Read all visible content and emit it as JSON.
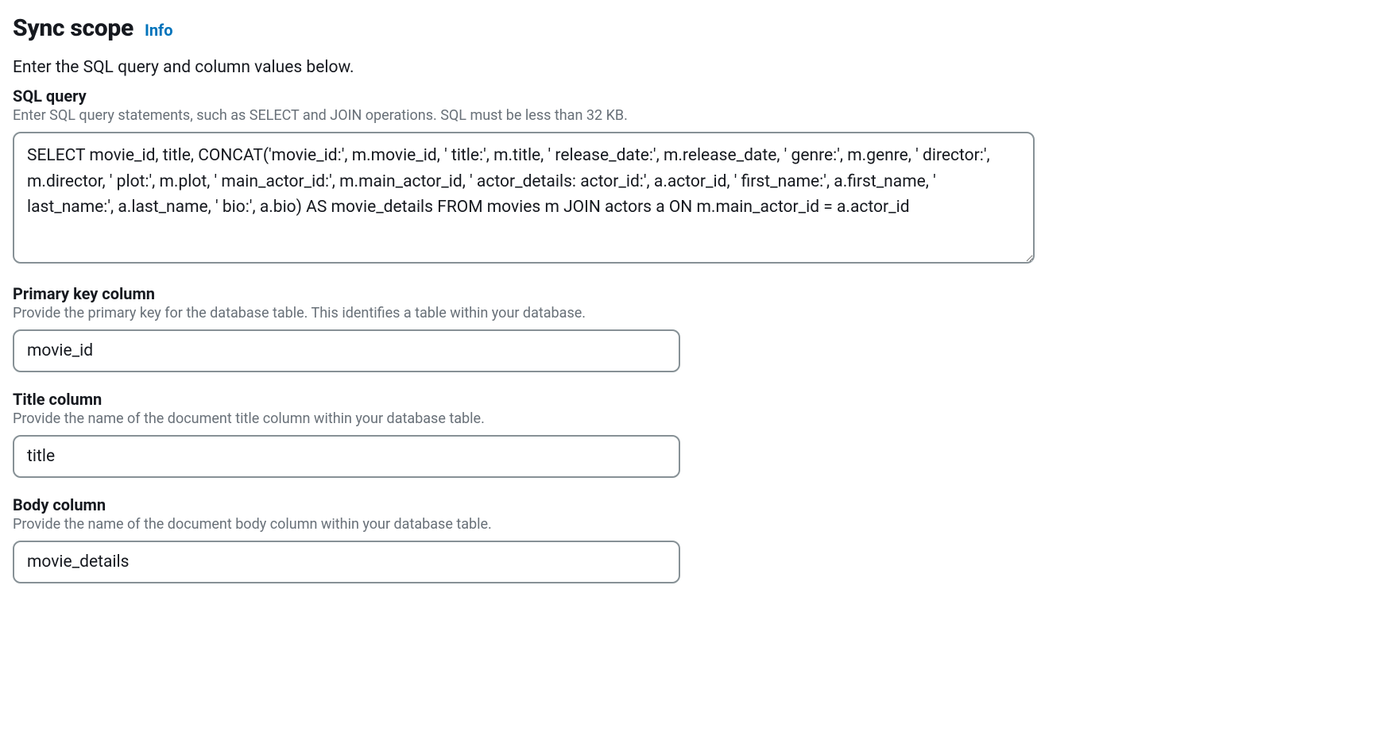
{
  "section": {
    "title": "Sync scope",
    "info_label": "Info",
    "intro": "Enter the SQL query and column values below."
  },
  "sql_query": {
    "label": "SQL query",
    "help": "Enter SQL query statements, such as SELECT and JOIN operations. SQL must be less than 32 KB.",
    "value": "SELECT movie_id, title, CONCAT('movie_id:', m.movie_id, ' title:', m.title, ' release_date:', m.release_date, ' genre:', m.genre, ' director:', m.director, ' plot:', m.plot, ' main_actor_id:', m.main_actor_id, ' actor_details: actor_id:', a.actor_id, ' first_name:', a.first_name, ' last_name:', a.last_name, ' bio:', a.bio) AS movie_details FROM movies m JOIN actors a ON m.main_actor_id = a.actor_id"
  },
  "primary_key": {
    "label": "Primary key column",
    "help": "Provide the primary key for the database table. This identifies a table within your database.",
    "value": "movie_id"
  },
  "title_col": {
    "label": "Title column",
    "help": "Provide the name of the document title column within your database table.",
    "value": "title"
  },
  "body_col": {
    "label": "Body column",
    "help": "Provide the name of the document body column within your database table.",
    "value": "movie_details"
  }
}
